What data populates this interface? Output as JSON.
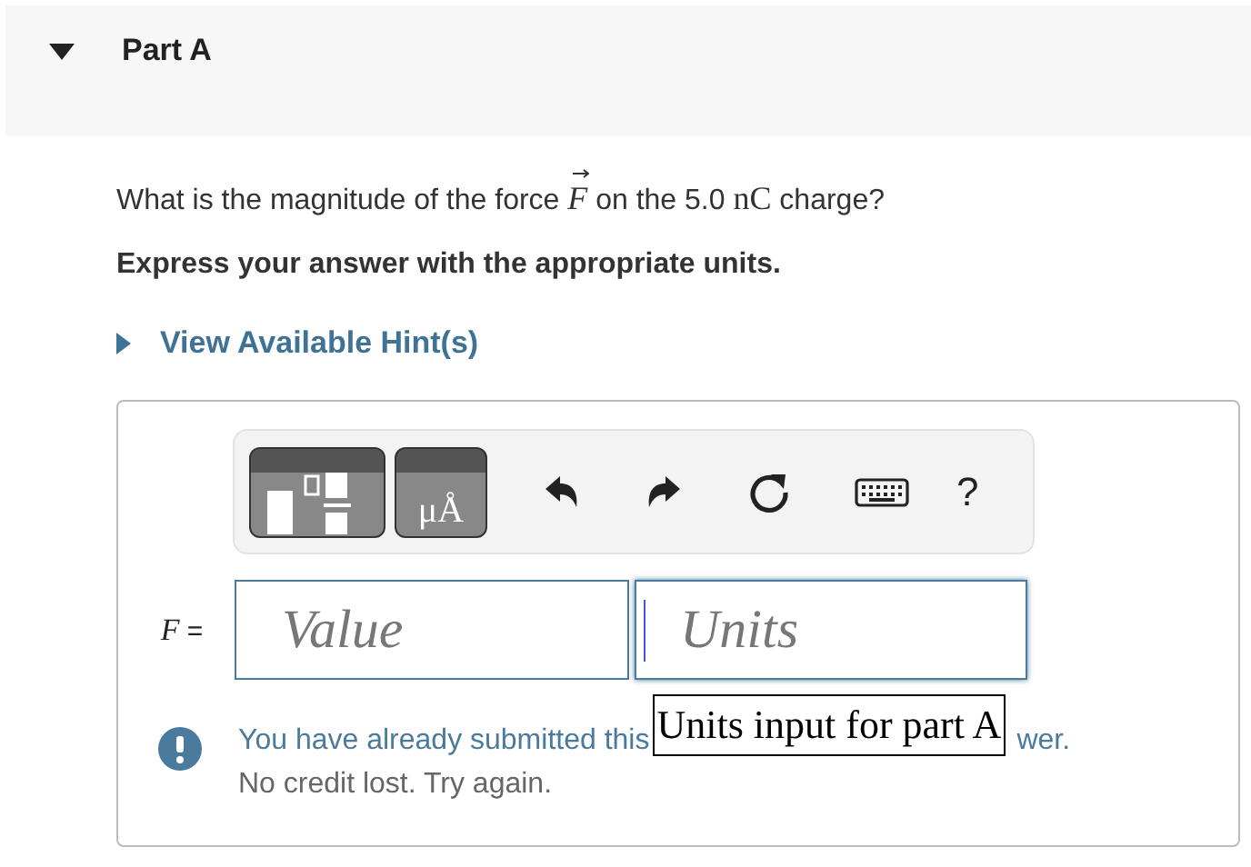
{
  "part": {
    "title": "Part A",
    "expanded": true
  },
  "question": {
    "before": "What is the magnitude of the force",
    "symbol": "F",
    "middle": "on the 5.0",
    "unit": "nC",
    "after": "charge?"
  },
  "instruction": "Express your answer with the appropriate units.",
  "hint": {
    "label": "View Available Hint(s)",
    "expanded": false
  },
  "toolbar": {
    "units_button": "μÅ",
    "help": "?"
  },
  "answer": {
    "label": "F",
    "equals": "=",
    "value_placeholder": "Value",
    "units_placeholder": "Units"
  },
  "feedback": {
    "line_1_start": "You have already submitted this",
    "line_1_end": "wer.",
    "line_2": "No credit lost. Try again."
  },
  "tooltip": "Units input for part A"
}
